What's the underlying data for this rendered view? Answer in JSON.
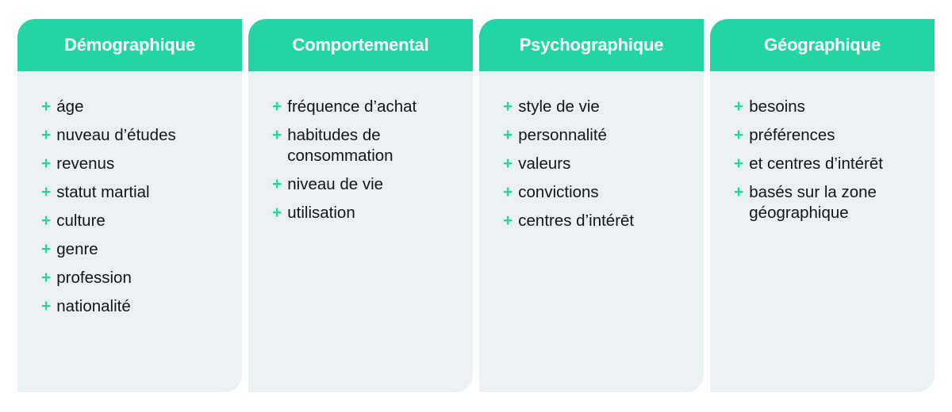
{
  "theme": {
    "page_background": "#ffffff",
    "header_color": "#21d6a4",
    "card_body_color": "#ebf0f3",
    "accent_color": "#21d6a4",
    "text_color": "#131617",
    "header_text_color": "#ffffff"
  },
  "bullet": {
    "glyph": "+",
    "icon_name": "plus-icon"
  },
  "columns": [
    {
      "id": "demographique",
      "title": "Démographique",
      "items": [
        "áge",
        "nuveau d’études",
        "revenus",
        "statut martial",
        "culture",
        "genre",
        "profession",
        "nationalité"
      ]
    },
    {
      "id": "comportemental",
      "title": "Comportemental",
      "items": [
        "fréquence d’achat",
        "habitudes de consommation",
        "niveau de vie",
        "utilisation"
      ]
    },
    {
      "id": "psychographique",
      "title": "Psychographique",
      "items": [
        "style de vie",
        "personnalité",
        "valeurs",
        "convictions",
        "centres d’intérēt"
      ]
    },
    {
      "id": "geographique",
      "title": "Géographique",
      "items": [
        "besoins",
        "préférences",
        "et centres d’intérēt",
        "basés sur la zone géographique"
      ]
    }
  ]
}
